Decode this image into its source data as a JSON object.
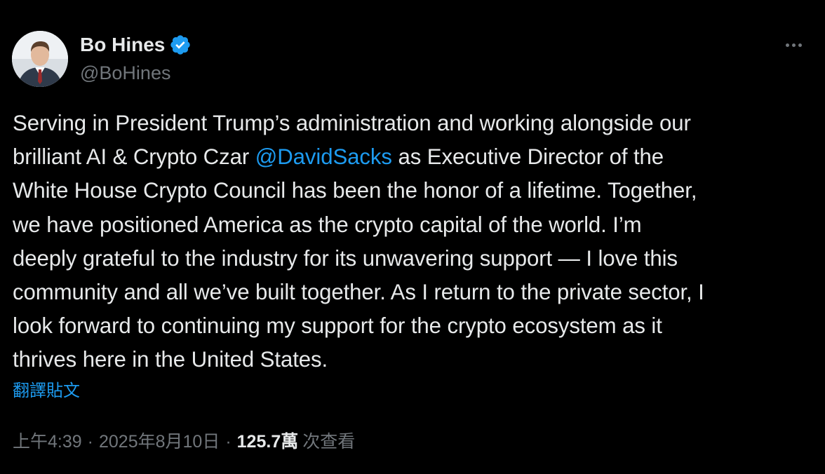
{
  "author": {
    "display_name": "Bo Hines",
    "handle": "@BoHines",
    "verified": true,
    "verified_color": "#1d9bf0"
  },
  "tweet": {
    "lines": [
      {
        "before": "Serving in President Trump’s administration and working alongside our",
        "mention": "",
        "after": ""
      },
      {
        "before": "brilliant AI & Crypto Czar ",
        "mention": "@DavidSacks",
        "after": " as Executive Director of the"
      },
      {
        "before": "White House Crypto Council has been the honor of a lifetime. Together,",
        "mention": "",
        "after": ""
      },
      {
        "before": "we have positioned America as the crypto capital of the world. I’m",
        "mention": "",
        "after": ""
      },
      {
        "before": "deeply grateful to the industry for its unwavering support — I love this",
        "mention": "",
        "after": ""
      },
      {
        "before": "community and all we’ve built together. As I return to the private sector, I",
        "mention": "",
        "after": ""
      },
      {
        "before": "look forward to continuing my support for the crypto ecosystem as it",
        "mention": "",
        "after": ""
      },
      {
        "before": "thrives here in the United States.",
        "mention": "",
        "after": ""
      }
    ],
    "translate_label": "翻譯貼文",
    "time": "上午4:39",
    "separator": "·",
    "date": "2025年8月10日",
    "views_count": "125.7萬",
    "views_label": "次查看"
  },
  "icons": {
    "more": "more-horizontal-icon",
    "verified": "verified-badge-icon"
  },
  "colors": {
    "background": "#000000",
    "text": "#e7e9ea",
    "muted": "#71767b",
    "link": "#1d9bf0"
  }
}
